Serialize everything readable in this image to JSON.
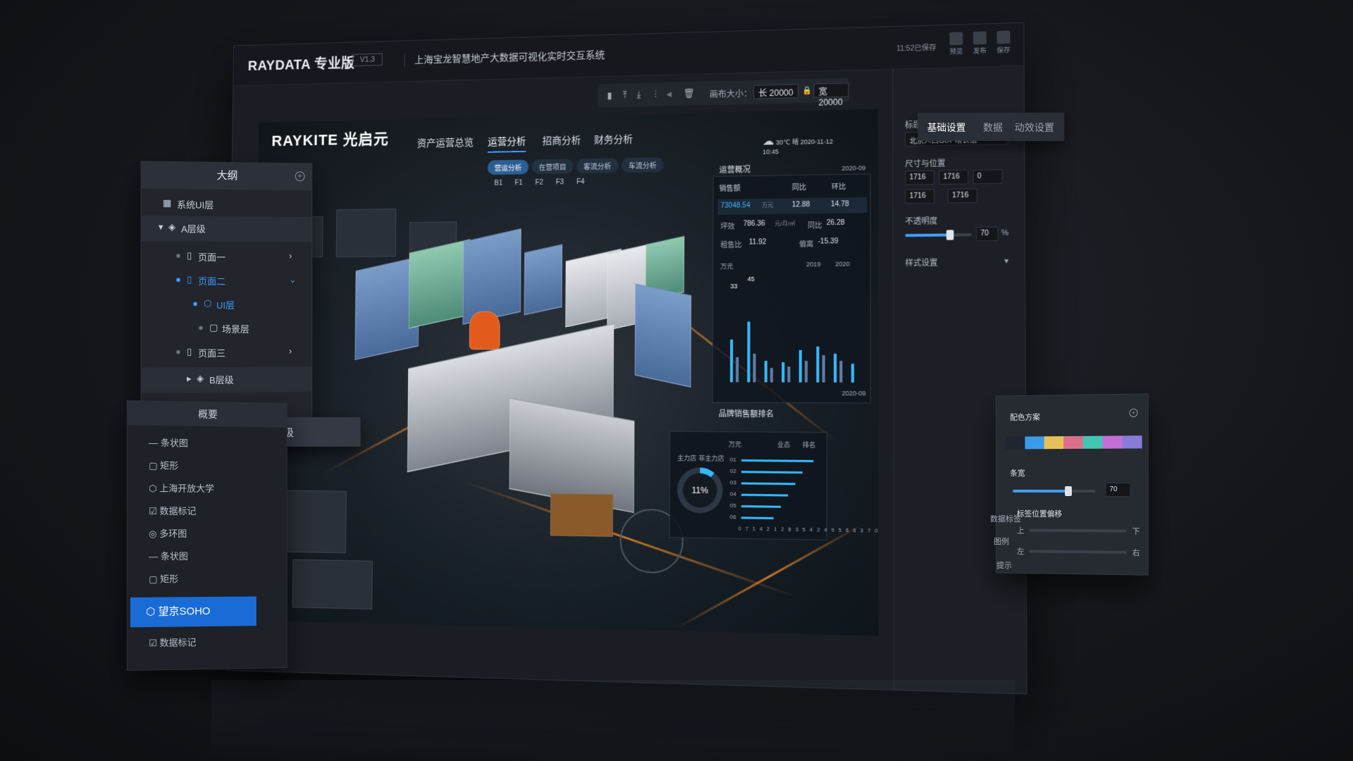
{
  "editor": {
    "brand": "RAYDATA 专业版",
    "version": "V1.3",
    "project_title": "上海宝龙智慧地产大数据可视化实时交互系统",
    "save_time": "11:52已保存",
    "top_buttons": [
      "预览",
      "发布",
      "保存"
    ],
    "canvas_size_label": "画布大小：",
    "canvas_length": "长 20000",
    "canvas_width": "宽 20000",
    "toolbar_icons": [
      "delete-icon",
      "align-top-icon",
      "align-bottom-icon",
      "distribute-icon",
      "distribute-h-icon",
      "trash-icon"
    ]
  },
  "scene": {
    "logo": "RAYKITE 光启元",
    "nav_tabs": [
      "资产运营总览",
      "运营分析",
      "招商分析",
      "财务分析"
    ],
    "active_nav": "运营分析",
    "sub_tabs": [
      "营运分析",
      "在营项目",
      "客流分析",
      "车流分析"
    ],
    "active_sub": "营运分析",
    "floors": [
      "B1",
      "F1",
      "F2",
      "F3",
      "F4"
    ],
    "weather": {
      "temp": "30℃",
      "date": "2020-11-12",
      "time": "10:45",
      "desc": "晴"
    },
    "ops_panel": {
      "title": "运营概况",
      "date": "2020-09",
      "headers": [
        "销售额",
        "同比",
        "环比"
      ],
      "sales": "73048.54",
      "sales_unit": "万元",
      "sales_yoy": "12.88",
      "sales_mom": "14.78",
      "avg_label": "坪效",
      "avg_value": "786.36",
      "avg_unit": "元/月/㎡",
      "avg_yoy_label": "同比",
      "avg_yoy": "26.28",
      "rent_label": "租售比",
      "rent_value": "11.92",
      "dev_label": "偏离",
      "dev_value": "-15.39",
      "chart_unit": "万元",
      "legend": [
        "2019",
        "2020"
      ],
      "bar_peak_labels": [
        "33",
        "45"
      ],
      "date2": "2020-09",
      "footer": "品牌销售额排名"
    },
    "ring_panel": {
      "tabs": [
        "主力店",
        "非主力店"
      ],
      "unit": "万元",
      "legend": [
        "业态",
        "排名"
      ],
      "ring_value": "11%",
      "rows": [
        "01",
        "02",
        "03",
        "04",
        "05",
        "06"
      ],
      "axis": [
        "0",
        "7",
        "14",
        "21",
        "28",
        "35",
        "42",
        "49",
        "56",
        "63",
        "70"
      ]
    }
  },
  "props": {
    "tabs": [
      "基础设置",
      "数据",
      "动效设置"
    ],
    "active_tab": "基础设置",
    "title_label": "标题",
    "title_value": "北京人口GDP增长值",
    "size_label": "尺寸与位置",
    "w": "1716",
    "h": "1716",
    "x": "0",
    "x2": "1716",
    "y2": "1716",
    "opacity_label": "不透明度",
    "opacity_value": "70",
    "opacity_unit": "%",
    "style_label": "样式设置"
  },
  "outline": {
    "title": "大纲",
    "items": [
      {
        "label": "系统UI层"
      },
      {
        "label": "A层级"
      },
      {
        "label": "页面一"
      },
      {
        "label": "页面二"
      },
      {
        "label": "UI层"
      },
      {
        "label": "场景层"
      },
      {
        "label": "页面三"
      },
      {
        "label": "B层级"
      }
    ],
    "floating_item": "C层级"
  },
  "summary": {
    "title": "概要",
    "items": [
      "条状图",
      "矩形",
      "上海开放大学",
      "数据标记",
      "多环图",
      "条状图",
      "矩形"
    ],
    "active_item": "望京SOHO",
    "after_item": "数据标记"
  },
  "colors": {
    "title": "配色方案",
    "swatches": [
      "#1f2630",
      "#3b9be8",
      "#e6c15a",
      "#d9708b",
      "#43c5b0",
      "#c36fd6",
      "#8a7bd9"
    ],
    "spacing_label": "条宽",
    "spacing_value": "70",
    "label_pos_label": "标签位置偏移",
    "up": "上",
    "down": "下",
    "left": "左",
    "right": "右",
    "side_labels": [
      "数据标签",
      "图例",
      "提示"
    ]
  }
}
